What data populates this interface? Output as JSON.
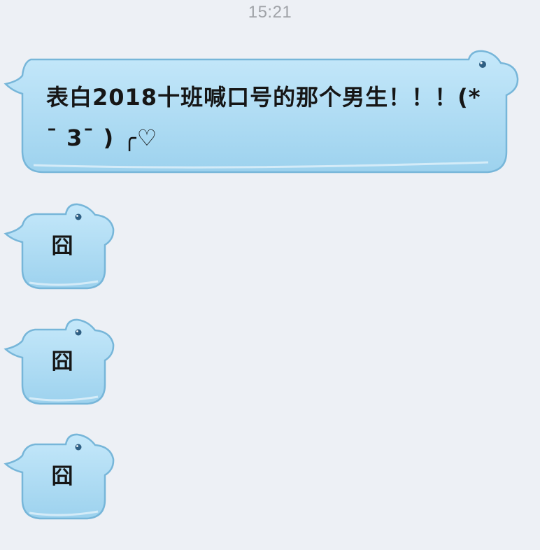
{
  "status_bar": {
    "time": "15:21"
  },
  "messages": [
    {
      "text": "表白2018十班喊口号的那个男生！！！(*¯ 3¯ ) ╭♡"
    },
    {
      "text": "囧"
    },
    {
      "text": "囧"
    },
    {
      "text": "囧"
    }
  ],
  "colors": {
    "background": "#edf0f5",
    "bubble_fill_top": "#bfe4f8",
    "bubble_fill_bottom": "#9fd3ef",
    "bubble_border": "#77b6d9",
    "text": "#161616",
    "timestamp": "#a0a3a8"
  },
  "icons": {
    "bubble_decoration": "hippo-icon"
  }
}
